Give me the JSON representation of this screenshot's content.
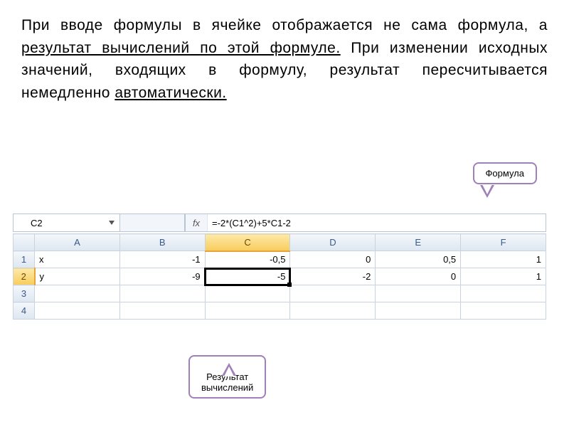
{
  "text": {
    "p1a": "При вводе формулы в ячейке отображается не сама формула, а ",
    "p1b": "результат вычислений по этой формуле.",
    "p1c": " При изменении исходных значений, входящих в формулу, результат пересчитывается немедленно ",
    "p1d": "автоматически."
  },
  "callouts": {
    "formula": "Формула",
    "result": "Результат\nвычислений"
  },
  "excel": {
    "name_box": "C2",
    "fx_label": "fx",
    "formula": "=-2*(C1^2)+5*C1-2",
    "columns": [
      "A",
      "B",
      "C",
      "D",
      "E",
      "F"
    ],
    "row_headers": [
      "1",
      "2",
      "3",
      "4"
    ],
    "rows": [
      {
        "label": "x",
        "cells": [
          "-1",
          "-0,5",
          "0",
          "0,5",
          "1"
        ]
      },
      {
        "label": "y",
        "cells": [
          "-9",
          "-5",
          "-2",
          "0",
          "1"
        ]
      },
      {
        "label": "",
        "cells": [
          "",
          "",
          "",
          "",
          ""
        ]
      },
      {
        "label": "",
        "cells": [
          "",
          "",
          "",
          "",
          ""
        ]
      }
    ],
    "active": {
      "row": 1,
      "col": 1
    }
  }
}
